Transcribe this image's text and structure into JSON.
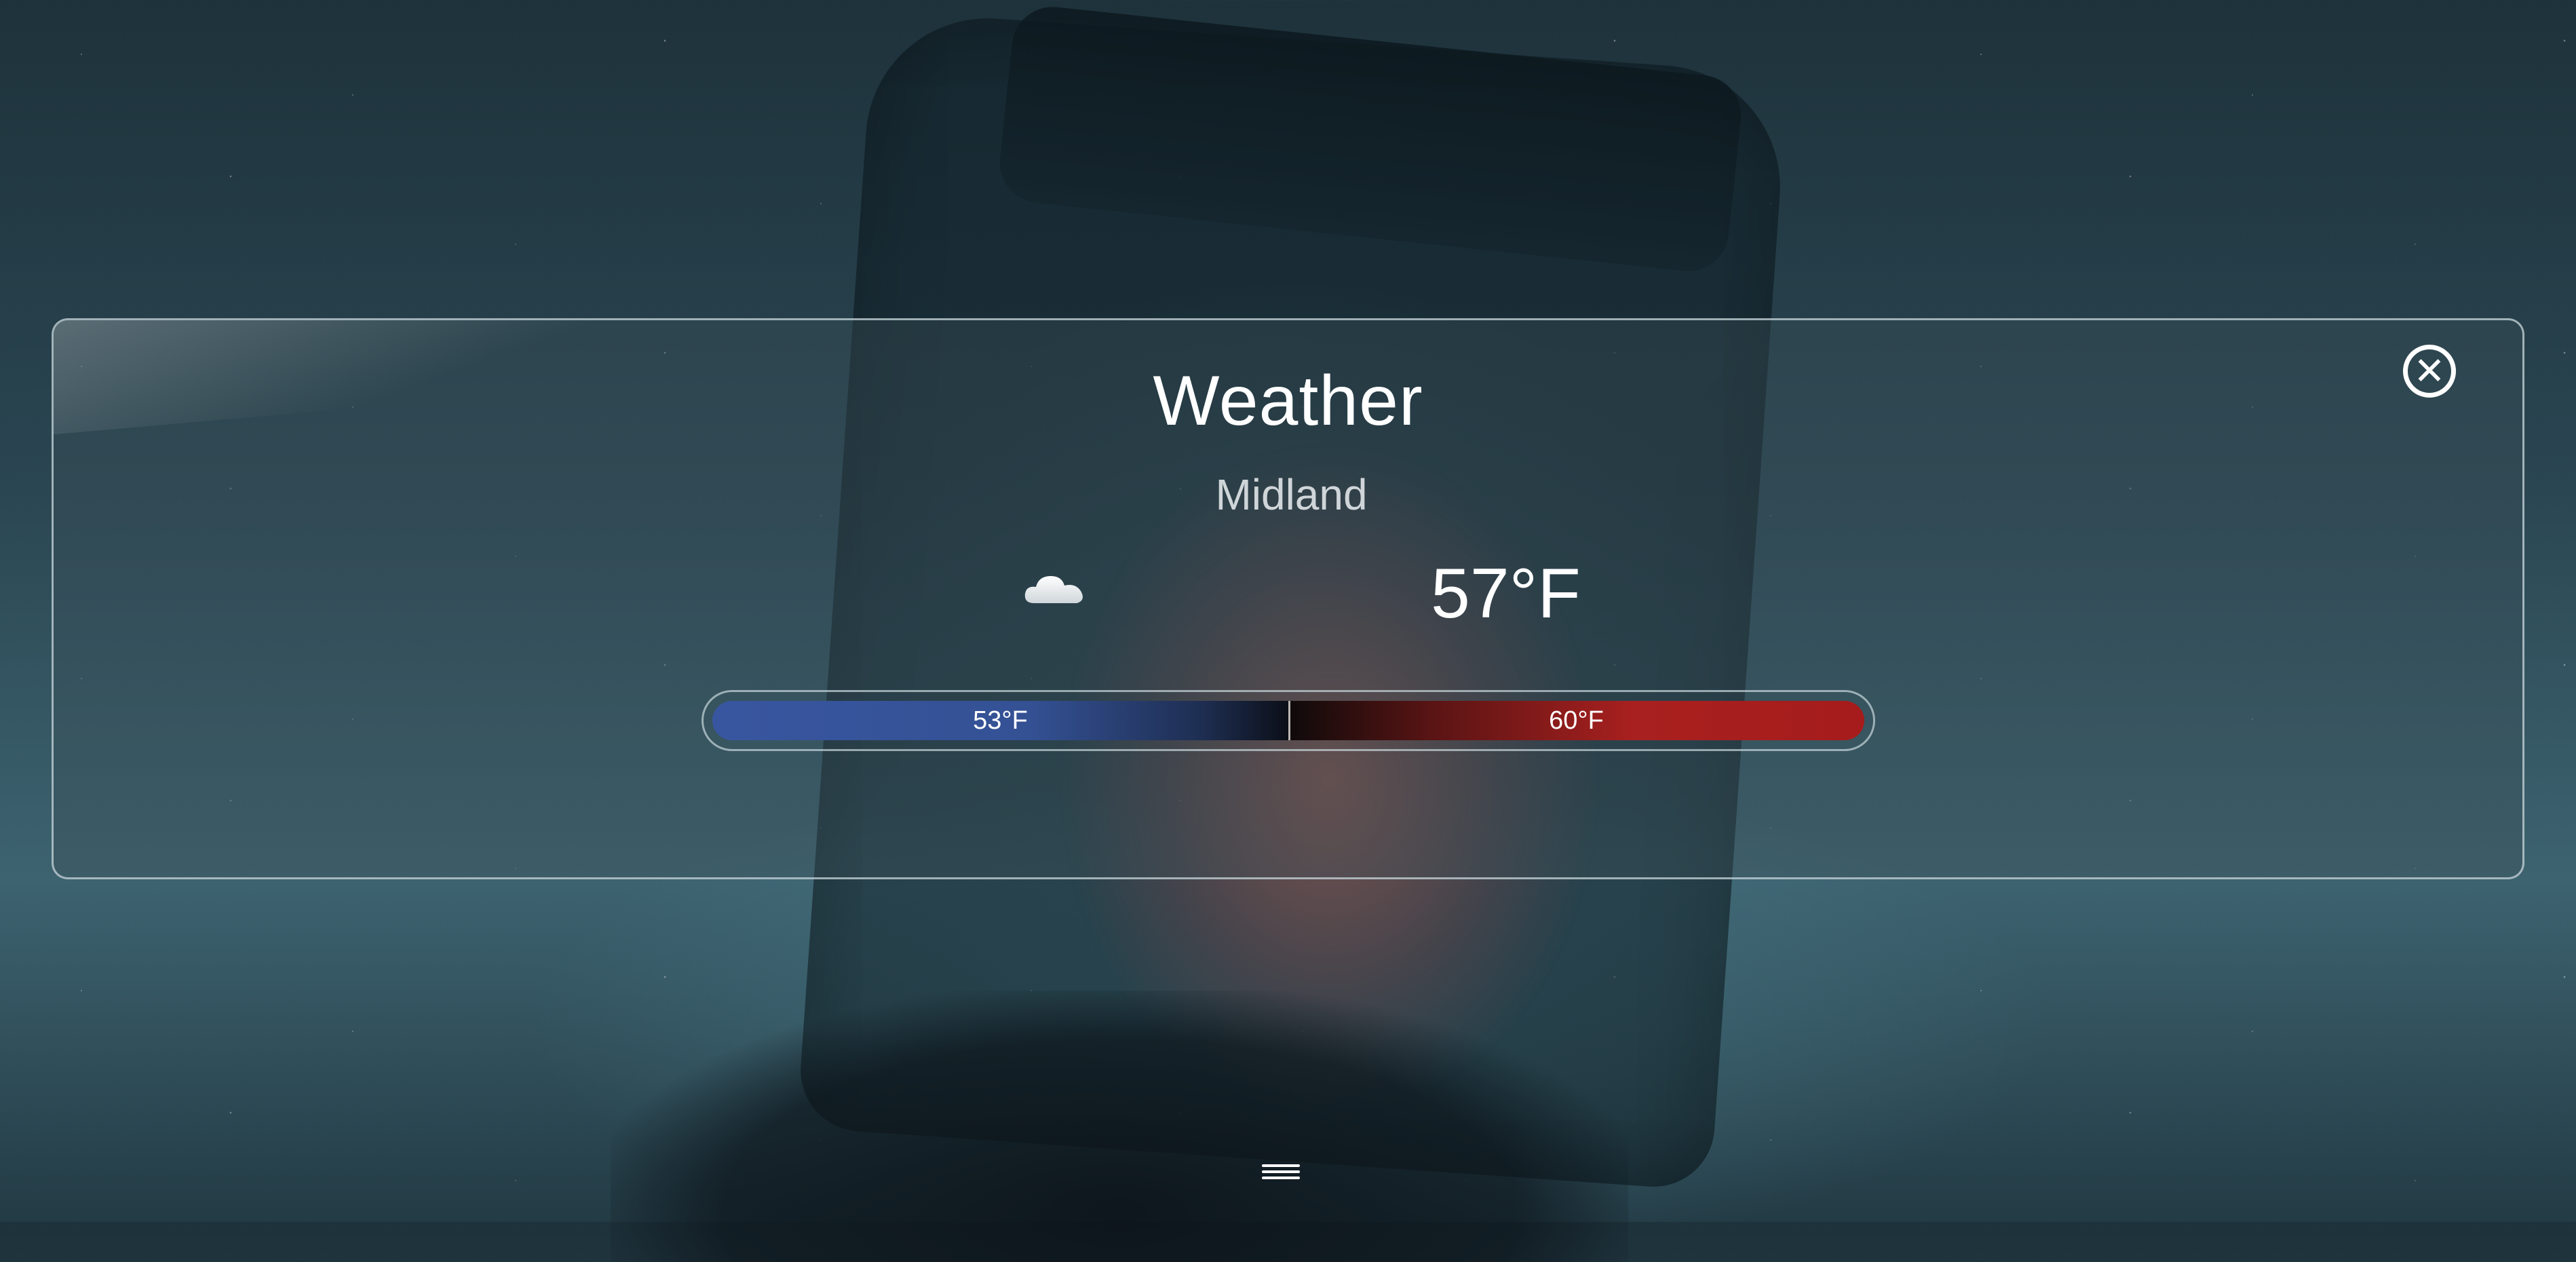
{
  "widget": {
    "title": "Weather",
    "location": "Midland",
    "condition_icon": "cloud-icon",
    "current_temperature": "57°F",
    "low_temperature": "53°F",
    "high_temperature": "60°F",
    "close_icon": "close-icon",
    "menu_icon": "menu-icon"
  },
  "colors": {
    "low_bar": "#3856a0",
    "high_bar": "#a8201f",
    "panel_border": "#c8d7dc",
    "text": "#ffffff"
  }
}
